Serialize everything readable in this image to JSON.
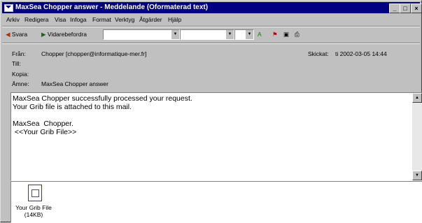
{
  "window": {
    "title": "MaxSea Chopper answer - Meddelande (Oformaterad text)",
    "minimize": "_",
    "maximize": "□",
    "close": "×"
  },
  "menu": [
    "Arkiv",
    "Redigera",
    "Visa",
    "Infoga",
    "Format",
    "Verktyg",
    "Åtgärder",
    "Hjälp"
  ],
  "toolbar": {
    "reply": "Svara",
    "forward": "Vidarebefordra"
  },
  "headers": {
    "from_label": "Från:",
    "from_value": "Chopper [chopper@informatique-mer.fr]",
    "sent_label": "Skickat:",
    "sent_value": "ti 2002-03-05 14:44",
    "to_label": "Till:",
    "to_value": "",
    "cc_label": "Kopia:",
    "cc_value": "",
    "subject_label": "Ämne:",
    "subject_value": "MaxSea Chopper answer"
  },
  "body": {
    "text": "MaxSea Chopper successfully processed your request.\nYour Grib file is attached to this mail.\n\nMaxSea  Chopper.\n <<Your Grib File>>"
  },
  "attachment": {
    "name": "Your Grib File",
    "size": "(14KB)"
  }
}
